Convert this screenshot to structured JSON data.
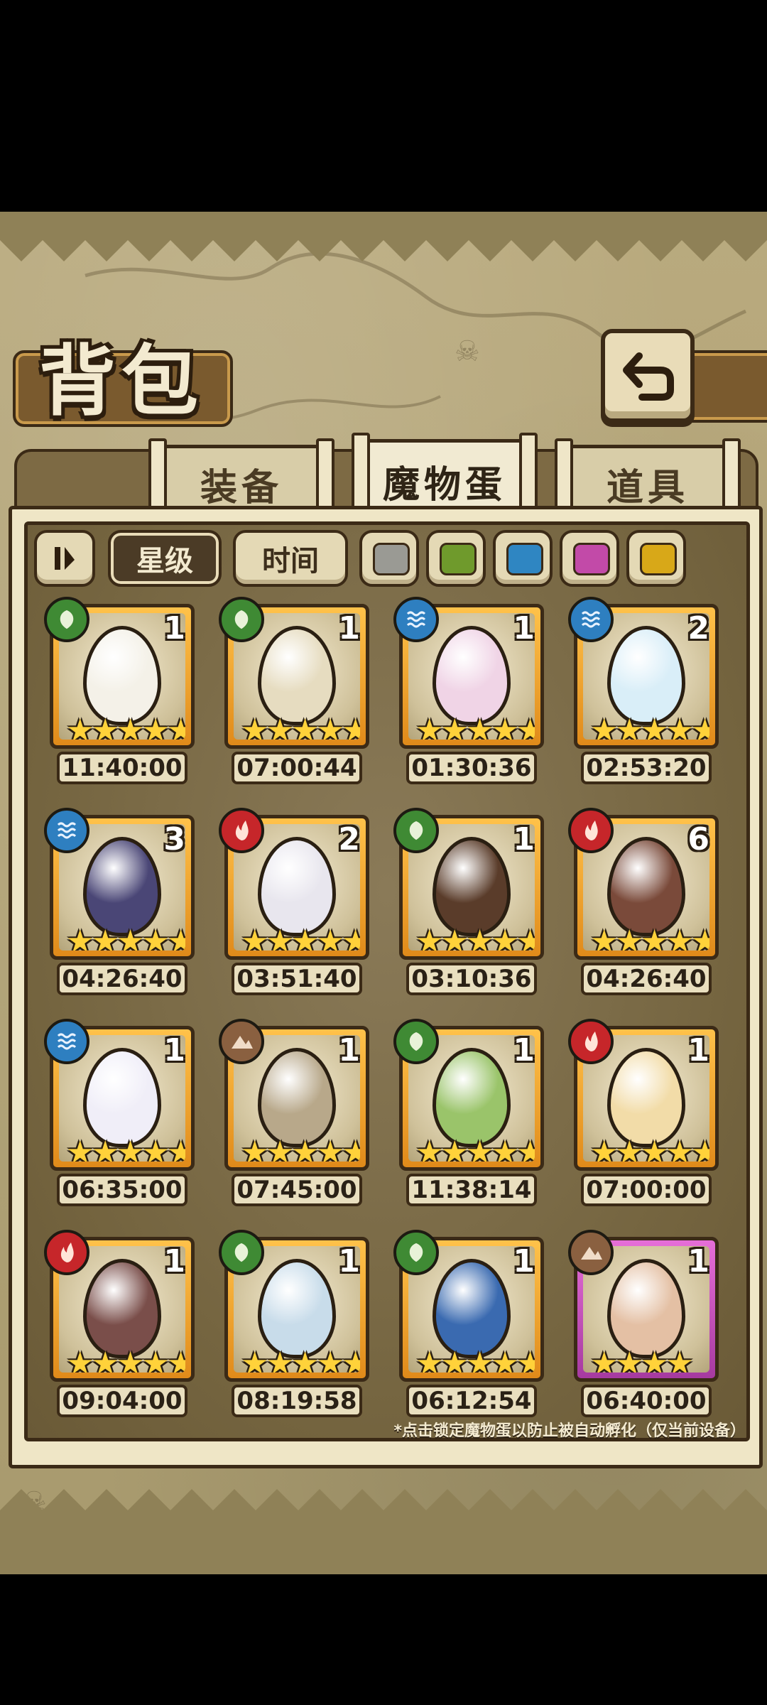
{
  "title": "背包",
  "tabs": [
    {
      "label": "装备",
      "active": false
    },
    {
      "label": "魔物蛋",
      "active": true
    },
    {
      "label": "道具",
      "active": false
    }
  ],
  "filters": {
    "sort_icon": "sort-toggle-icon",
    "star_label": "星级",
    "time_label": "时间",
    "swatches": [
      "#9a9a94",
      "#6f9a2c",
      "#2f86c2",
      "#c24aa8",
      "#d8a818"
    ]
  },
  "element_colors": {
    "grass": "#3f8a34",
    "water": "#2e7fc0",
    "fire": "#c6262a",
    "earth": "#8a6040"
  },
  "eggs": [
    {
      "element": "grass",
      "count": "1",
      "stars": 5,
      "timer": "11:40:00",
      "color": "#f4f1e8",
      "frame": "gold"
    },
    {
      "element": "grass",
      "count": "1",
      "stars": 5,
      "timer": "07:00:44",
      "color": "#e6dcc0",
      "frame": "gold"
    },
    {
      "element": "water",
      "count": "1",
      "stars": 5,
      "timer": "01:30:36",
      "color": "#f0d4e6",
      "frame": "gold"
    },
    {
      "element": "water",
      "count": "2",
      "stars": 5,
      "timer": "02:53:20",
      "color": "#d9eef8",
      "frame": "gold"
    },
    {
      "element": "water",
      "count": "3",
      "stars": 5,
      "timer": "04:26:40",
      "color": "#4a4676",
      "frame": "gold"
    },
    {
      "element": "fire",
      "count": "2",
      "stars": 5,
      "timer": "03:51:40",
      "color": "#e8e6ee",
      "frame": "gold"
    },
    {
      "element": "grass",
      "count": "1",
      "stars": 5,
      "timer": "03:10:36",
      "color": "#5a3c2a",
      "frame": "gold"
    },
    {
      "element": "fire",
      "count": "6",
      "stars": 5,
      "timer": "04:26:40",
      "color": "#7a4a3a",
      "frame": "gold"
    },
    {
      "element": "water",
      "count": "1",
      "stars": 5,
      "timer": "06:35:00",
      "color": "#f0eef8",
      "frame": "gold"
    },
    {
      "element": "earth",
      "count": "1",
      "stars": 5,
      "timer": "07:45:00",
      "color": "#b8a88a",
      "frame": "gold"
    },
    {
      "element": "grass",
      "count": "1",
      "stars": 5,
      "timer": "11:38:14",
      "color": "#9ac46a",
      "frame": "gold"
    },
    {
      "element": "fire",
      "count": "1",
      "stars": 5,
      "timer": "07:00:00",
      "color": "#f2dca8",
      "frame": "gold"
    },
    {
      "element": "fire",
      "count": "1",
      "stars": 5,
      "timer": "09:04:00",
      "color": "#7a4e4a",
      "frame": "gold"
    },
    {
      "element": "grass",
      "count": "1",
      "stars": 5,
      "timer": "08:19:58",
      "color": "#c8dcea",
      "frame": "gold"
    },
    {
      "element": "grass",
      "count": "1",
      "stars": 5,
      "timer": "06:12:54",
      "color": "#3a6ab0",
      "frame": "gold"
    },
    {
      "element": "earth",
      "count": "1",
      "stars": 4,
      "timer": "06:40:00",
      "color": "#e4c0a4",
      "frame": "purple"
    }
  ],
  "footnote": "*点击锁定魔物蛋以防止被自动孵化（仅当前设备）"
}
